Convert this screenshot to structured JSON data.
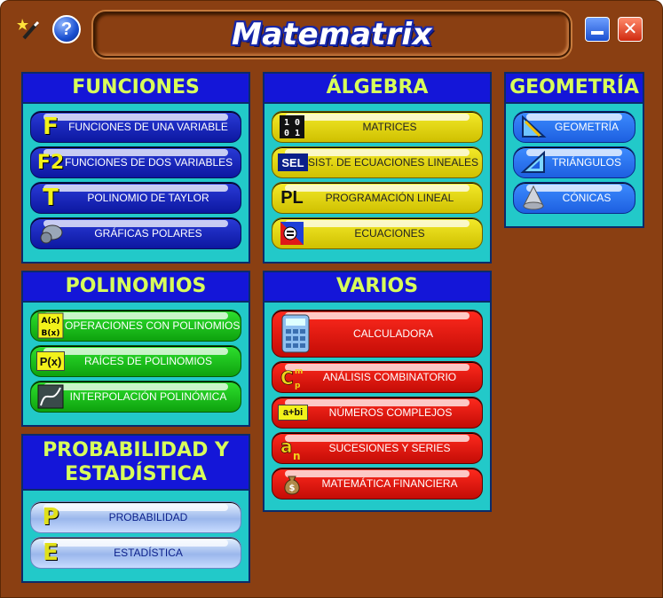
{
  "window": {
    "title": "Matematrix",
    "help_glyph": "?",
    "close_glyph": "✕",
    "colors": {
      "frame": "#8a3f12",
      "panel": "#22c9c9",
      "header": "#1416d8",
      "header_text": "#d8ff5a"
    }
  },
  "sections": {
    "funciones": {
      "title": "FUNCIONES",
      "items": [
        {
          "label": "FUNCIONES DE UNA VARIABLE",
          "icon_text": "F",
          "icon": "f-letter-icon"
        },
        {
          "label": "FUNCIONES DE DOS VARIABLES",
          "icon_text": "F2",
          "icon": "f2-letter-icon"
        },
        {
          "label": "POLINOMIO DE TAYLOR",
          "icon_text": "T",
          "icon": "t-letter-icon"
        },
        {
          "label": "GRÁFICAS POLARES",
          "icon": "polar-graph-icon"
        }
      ]
    },
    "algebra": {
      "title": "ÁLGEBRA",
      "items": [
        {
          "label": "MATRICES",
          "icon_text": "1 0\n0 1",
          "icon": "matrix-icon"
        },
        {
          "label": "SIST. DE ECUACIONES LINEALES",
          "icon_text": "SEL",
          "icon": "sel-icon"
        },
        {
          "label": "PROGRAMACIÓN LINEAL",
          "icon_text": "PL",
          "icon": "pl-icon"
        },
        {
          "label": "ECUACIONES",
          "icon": "equations-icon"
        }
      ]
    },
    "geometria": {
      "title": "GEOMETRÍA",
      "items": [
        {
          "label": "GEOMETRÍA",
          "icon": "set-square-icon"
        },
        {
          "label": "TRIÁNGULOS",
          "icon": "triangle-icon"
        },
        {
          "label": "CÓNICAS",
          "icon": "cone-icon"
        }
      ]
    },
    "polinomios": {
      "title": "POLINOMIOS",
      "items": [
        {
          "label": "OPERACIONES CON POLINOMIOS",
          "icon_text": "A(x) B(x)",
          "icon": "polynomial-operations-icon"
        },
        {
          "label": "RAÍCES DE POLINOMIOS",
          "icon_text": "P(x)",
          "icon": "px-icon"
        },
        {
          "label": "INTERPOLACIÓN POLINÓMICA",
          "icon": "interpolation-icon"
        }
      ]
    },
    "varios": {
      "title": "VARIOS",
      "items": [
        {
          "label": "CALCULADORA",
          "icon": "calculator-icon"
        },
        {
          "label": "ANÁLISIS COMBINATORIO",
          "icon_text": "Cmp",
          "icon": "combinatorics-icon"
        },
        {
          "label": "NÚMEROS COMPLEJOS",
          "icon_text": "a+bi",
          "icon": "complex-numbers-icon"
        },
        {
          "label": "SUCESIONES Y SERIES",
          "icon_text": "an",
          "icon": "sequences-icon"
        },
        {
          "label": "MATEMÁTICA FINANCIERA",
          "icon": "money-bag-icon"
        }
      ]
    },
    "probabilidad": {
      "title": "PROBABILIDAD Y ESTADÍSTICA",
      "items": [
        {
          "label": "PROBABILIDAD",
          "icon_text": "P",
          "icon": "p-letter-icon"
        },
        {
          "label": "ESTADÍSTICA",
          "icon_text": "E",
          "icon": "e-letter-icon"
        }
      ]
    }
  }
}
